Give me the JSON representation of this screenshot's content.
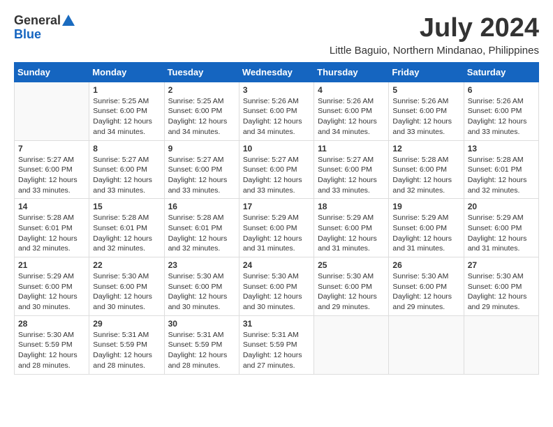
{
  "logo": {
    "general": "General",
    "blue": "Blue"
  },
  "title": "July 2024",
  "subtitle": "Little Baguio, Northern Mindanao, Philippines",
  "days_of_week": [
    "Sunday",
    "Monday",
    "Tuesday",
    "Wednesday",
    "Thursday",
    "Friday",
    "Saturday"
  ],
  "weeks": [
    [
      {
        "day": "",
        "info": ""
      },
      {
        "day": "1",
        "info": "Sunrise: 5:25 AM\nSunset: 6:00 PM\nDaylight: 12 hours\nand 34 minutes."
      },
      {
        "day": "2",
        "info": "Sunrise: 5:25 AM\nSunset: 6:00 PM\nDaylight: 12 hours\nand 34 minutes."
      },
      {
        "day": "3",
        "info": "Sunrise: 5:26 AM\nSunset: 6:00 PM\nDaylight: 12 hours\nand 34 minutes."
      },
      {
        "day": "4",
        "info": "Sunrise: 5:26 AM\nSunset: 6:00 PM\nDaylight: 12 hours\nand 34 minutes."
      },
      {
        "day": "5",
        "info": "Sunrise: 5:26 AM\nSunset: 6:00 PM\nDaylight: 12 hours\nand 33 minutes."
      },
      {
        "day": "6",
        "info": "Sunrise: 5:26 AM\nSunset: 6:00 PM\nDaylight: 12 hours\nand 33 minutes."
      }
    ],
    [
      {
        "day": "7",
        "info": "Sunrise: 5:27 AM\nSunset: 6:00 PM\nDaylight: 12 hours\nand 33 minutes."
      },
      {
        "day": "8",
        "info": "Sunrise: 5:27 AM\nSunset: 6:00 PM\nDaylight: 12 hours\nand 33 minutes."
      },
      {
        "day": "9",
        "info": "Sunrise: 5:27 AM\nSunset: 6:00 PM\nDaylight: 12 hours\nand 33 minutes."
      },
      {
        "day": "10",
        "info": "Sunrise: 5:27 AM\nSunset: 6:00 PM\nDaylight: 12 hours\nand 33 minutes."
      },
      {
        "day": "11",
        "info": "Sunrise: 5:27 AM\nSunset: 6:00 PM\nDaylight: 12 hours\nand 33 minutes."
      },
      {
        "day": "12",
        "info": "Sunrise: 5:28 AM\nSunset: 6:00 PM\nDaylight: 12 hours\nand 32 minutes."
      },
      {
        "day": "13",
        "info": "Sunrise: 5:28 AM\nSunset: 6:01 PM\nDaylight: 12 hours\nand 32 minutes."
      }
    ],
    [
      {
        "day": "14",
        "info": "Sunrise: 5:28 AM\nSunset: 6:01 PM\nDaylight: 12 hours\nand 32 minutes."
      },
      {
        "day": "15",
        "info": "Sunrise: 5:28 AM\nSunset: 6:01 PM\nDaylight: 12 hours\nand 32 minutes."
      },
      {
        "day": "16",
        "info": "Sunrise: 5:28 AM\nSunset: 6:01 PM\nDaylight: 12 hours\nand 32 minutes."
      },
      {
        "day": "17",
        "info": "Sunrise: 5:29 AM\nSunset: 6:00 PM\nDaylight: 12 hours\nand 31 minutes."
      },
      {
        "day": "18",
        "info": "Sunrise: 5:29 AM\nSunset: 6:00 PM\nDaylight: 12 hours\nand 31 minutes."
      },
      {
        "day": "19",
        "info": "Sunrise: 5:29 AM\nSunset: 6:00 PM\nDaylight: 12 hours\nand 31 minutes."
      },
      {
        "day": "20",
        "info": "Sunrise: 5:29 AM\nSunset: 6:00 PM\nDaylight: 12 hours\nand 31 minutes."
      }
    ],
    [
      {
        "day": "21",
        "info": "Sunrise: 5:29 AM\nSunset: 6:00 PM\nDaylight: 12 hours\nand 30 minutes."
      },
      {
        "day": "22",
        "info": "Sunrise: 5:30 AM\nSunset: 6:00 PM\nDaylight: 12 hours\nand 30 minutes."
      },
      {
        "day": "23",
        "info": "Sunrise: 5:30 AM\nSunset: 6:00 PM\nDaylight: 12 hours\nand 30 minutes."
      },
      {
        "day": "24",
        "info": "Sunrise: 5:30 AM\nSunset: 6:00 PM\nDaylight: 12 hours\nand 30 minutes."
      },
      {
        "day": "25",
        "info": "Sunrise: 5:30 AM\nSunset: 6:00 PM\nDaylight: 12 hours\nand 29 minutes."
      },
      {
        "day": "26",
        "info": "Sunrise: 5:30 AM\nSunset: 6:00 PM\nDaylight: 12 hours\nand 29 minutes."
      },
      {
        "day": "27",
        "info": "Sunrise: 5:30 AM\nSunset: 6:00 PM\nDaylight: 12 hours\nand 29 minutes."
      }
    ],
    [
      {
        "day": "28",
        "info": "Sunrise: 5:30 AM\nSunset: 5:59 PM\nDaylight: 12 hours\nand 28 minutes."
      },
      {
        "day": "29",
        "info": "Sunrise: 5:31 AM\nSunset: 5:59 PM\nDaylight: 12 hours\nand 28 minutes."
      },
      {
        "day": "30",
        "info": "Sunrise: 5:31 AM\nSunset: 5:59 PM\nDaylight: 12 hours\nand 28 minutes."
      },
      {
        "day": "31",
        "info": "Sunrise: 5:31 AM\nSunset: 5:59 PM\nDaylight: 12 hours\nand 27 minutes."
      },
      {
        "day": "",
        "info": ""
      },
      {
        "day": "",
        "info": ""
      },
      {
        "day": "",
        "info": ""
      }
    ]
  ]
}
